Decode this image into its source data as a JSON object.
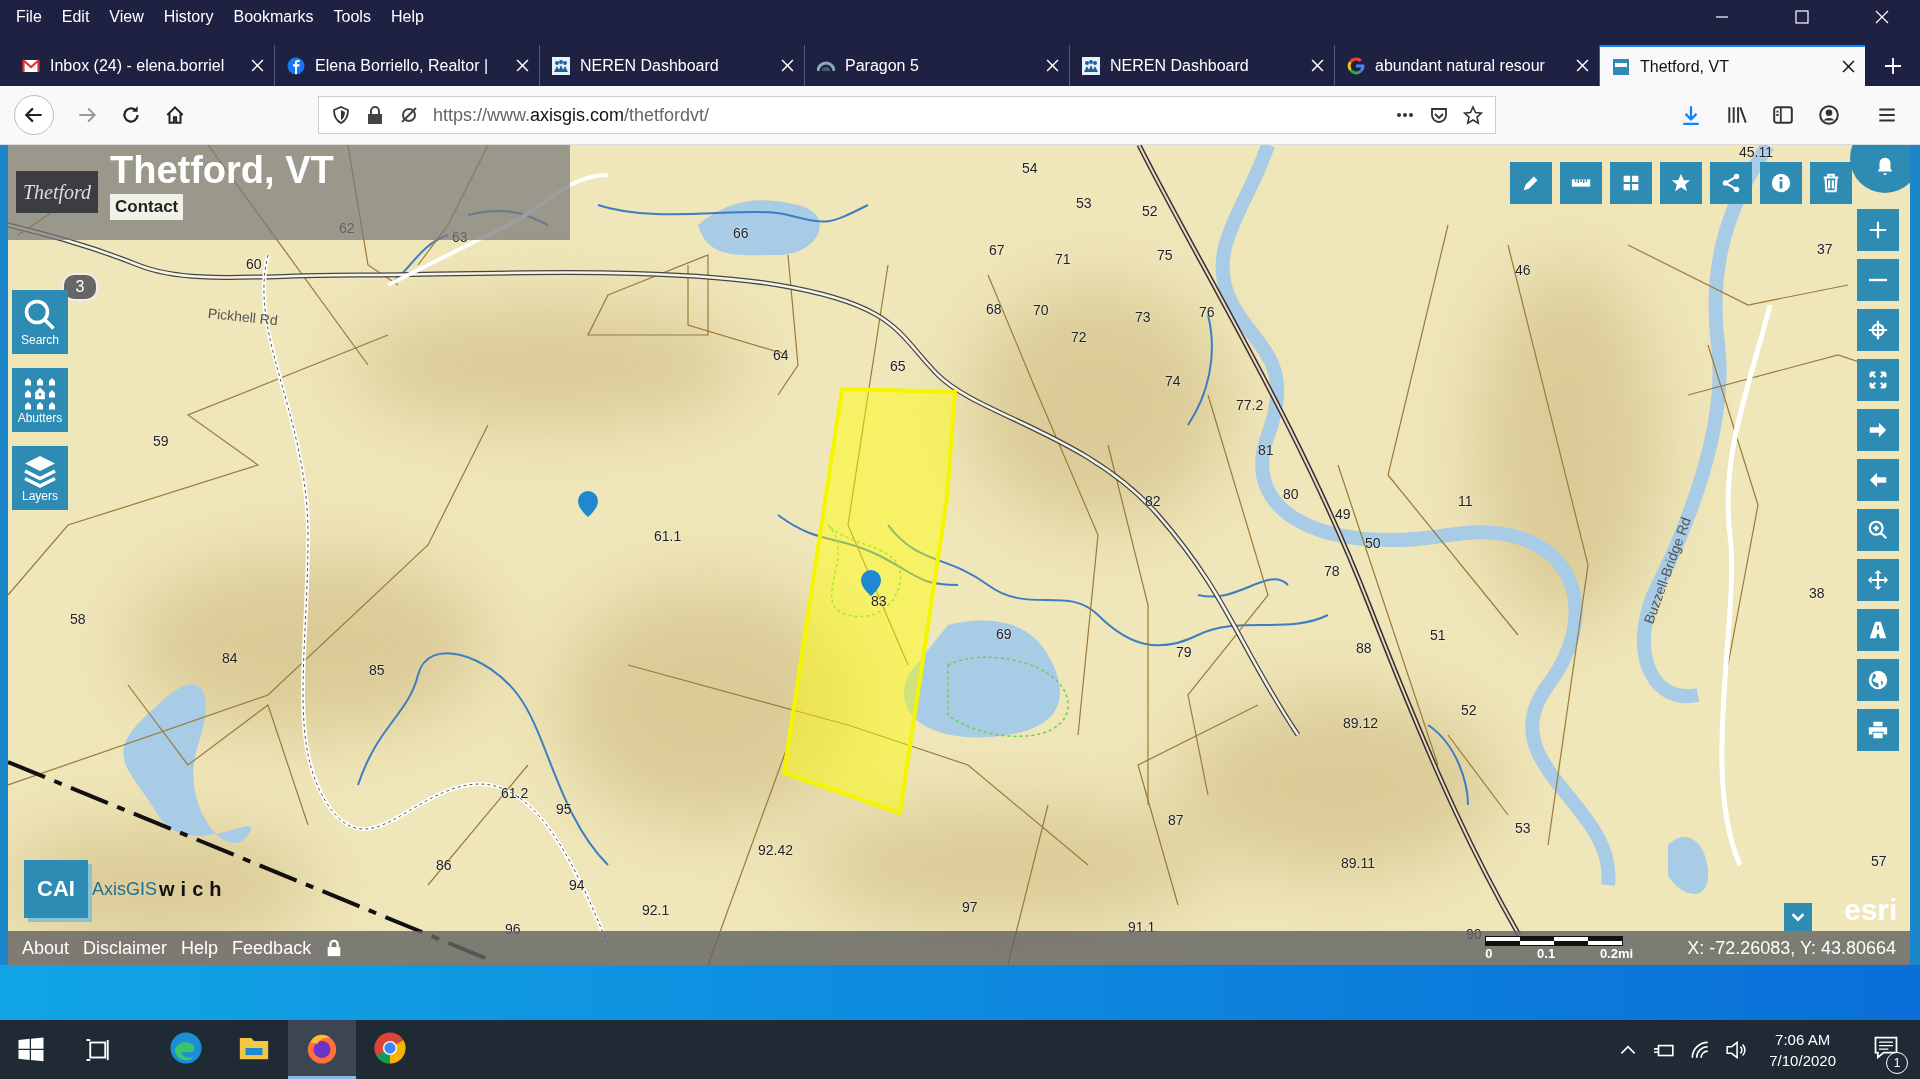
{
  "menu_bar": [
    "File",
    "Edit",
    "View",
    "History",
    "Bookmarks",
    "Tools",
    "Help"
  ],
  "tabs": [
    {
      "title": "Inbox (24) - elena.borriel",
      "kind": "mail",
      "selected": false
    },
    {
      "title": "Elena Borriello, Realtor |",
      "kind": "social",
      "selected": false
    },
    {
      "title": "NEREN Dashboard",
      "kind": "people",
      "selected": false
    },
    {
      "title": "Paragon 5",
      "kind": "arc",
      "selected": false
    },
    {
      "title": "NEREN Dashboard",
      "kind": "people",
      "selected": false
    },
    {
      "title": "abundant natural resour",
      "kind": "ring",
      "selected": false
    },
    {
      "title": "Thetford, VT",
      "kind": "square",
      "selected": true
    }
  ],
  "address_bar": {
    "url_prefix": "https://www.",
    "url_domain": "axisgis.com",
    "url_path": "/thetfordvt/"
  },
  "map": {
    "header": {
      "logo_text": "Thetford",
      "title": "Thetford, VT",
      "contact": "Contact"
    },
    "result_count": "3",
    "side_tools": [
      {
        "label": "Search",
        "kind": "search"
      },
      {
        "label": "Abutters",
        "kind": "houses"
      },
      {
        "label": "Layers",
        "kind": "layers"
      }
    ],
    "top_tools": [
      {
        "kind": "pencil"
      },
      {
        "kind": "ruler"
      },
      {
        "kind": "grid"
      },
      {
        "kind": "star"
      },
      {
        "kind": "share"
      },
      {
        "kind": "info"
      },
      {
        "kind": "trash"
      }
    ],
    "right_tools": [
      {
        "kind": "plus"
      },
      {
        "kind": "minus"
      },
      {
        "kind": "crosshair"
      },
      {
        "kind": "expand"
      },
      {
        "kind": "arrow-right"
      },
      {
        "kind": "arrow-left"
      },
      {
        "kind": "zoom-in"
      },
      {
        "kind": "move"
      },
      {
        "kind": "road"
      },
      {
        "kind": "globe"
      },
      {
        "kind": "printer"
      }
    ],
    "parcel_labels": [
      "54",
      "53",
      "52",
      "45.11",
      "66",
      "67",
      "71",
      "75",
      "76",
      "73",
      "72",
      "68",
      "70",
      "65",
      "64",
      "62",
      "63",
      "60",
      "59",
      "61.1",
      "74",
      "77.2",
      "81",
      "82",
      "80",
      "49",
      "50",
      "11",
      "46",
      "37",
      "38",
      "78",
      "88",
      "51",
      "52",
      "89.12",
      "79",
      "69",
      "83",
      "58",
      "84",
      "85",
      "61.2",
      "95",
      "94",
      "92.42",
      "92.1",
      "86",
      "96",
      "97",
      "87",
      "91.1",
      "89.11",
      "53",
      "57",
      "90"
    ],
    "road_labels": [
      "Pickhell Rd",
      "Buzzell-Bridge Rd"
    ],
    "brand": {
      "logo": "CAI",
      "product": "AxisGIS",
      "town": "wich"
    },
    "esri": "esri",
    "footer": {
      "links": [
        "About",
        "Disclaimer",
        "Help",
        "Feedback"
      ],
      "scale": [
        "0",
        "0.1",
        "0.2mi"
      ],
      "coordinates": "X: -72.26083, Y: 43.80664"
    }
  },
  "taskbar": {
    "apps": [
      {
        "kind": "edge",
        "selected": false
      },
      {
        "kind": "folder",
        "selected": false
      },
      {
        "kind": "firefox",
        "selected": true
      },
      {
        "kind": "chrome",
        "selected": false
      }
    ],
    "time": "7:06 AM",
    "date": "7/10/2020",
    "notifications": "1"
  }
}
